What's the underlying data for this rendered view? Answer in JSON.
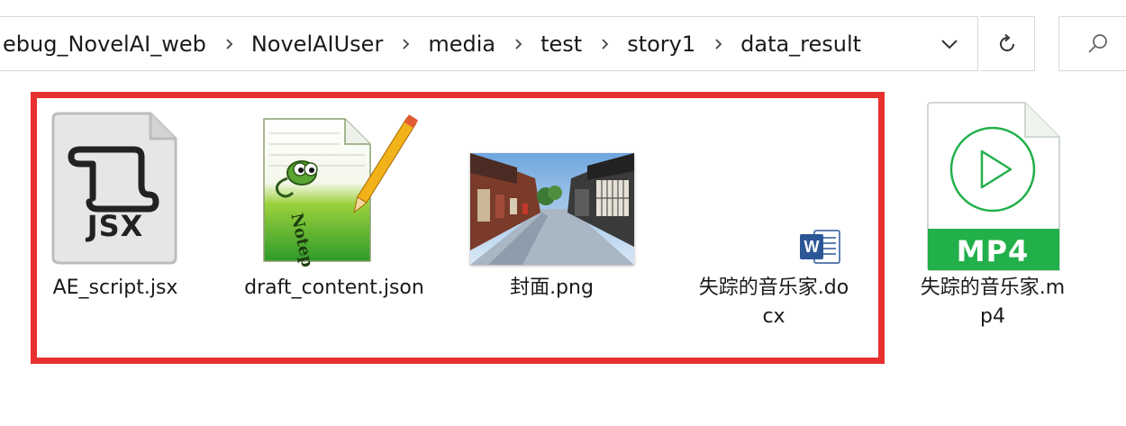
{
  "address_bar": {
    "crumbs": [
      "ebug_NovelAI_web",
      "NovelAIUser",
      "media",
      "test",
      "story1",
      "data_result"
    ]
  },
  "files": [
    {
      "name": "AE_script.jsx",
      "icon": "jsx-script-icon",
      "badge": "JSX"
    },
    {
      "name": "draft_content.json",
      "icon": "notepad-plus-plus-icon"
    },
    {
      "name": "封面.png",
      "icon": "street-photo-thumbnail"
    },
    {
      "name": "失踪的音乐家.docx",
      "icon": "word-document-icon",
      "badge": "W"
    },
    {
      "name": "失踪的音乐家.mp4",
      "icon": "mp4-video-icon",
      "badge": "MP4"
    }
  ],
  "colors": {
    "highlight": "#e8312f",
    "mp4_green": "#22b04a",
    "word_blue": "#2b5797"
  }
}
